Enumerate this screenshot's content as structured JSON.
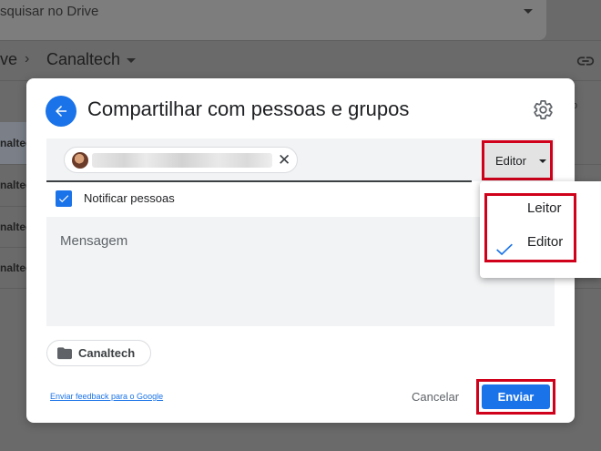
{
  "background": {
    "search_placeholder": "squisar no Drive",
    "breadcrumb_prev": "ve",
    "breadcrumb_current": "Canaltech",
    "file_rows": [
      "naltec",
      "naltec",
      "naltec",
      "naltec"
    ],
    "right_text": "o"
  },
  "dialog": {
    "title": "Compartilhar com pessoas e grupos",
    "role_button_label": "Editor",
    "notify_label": "Notificar pessoas",
    "notify_checked": true,
    "message_placeholder": "Mensagem",
    "folder_chip_label": "Canaltech",
    "feedback_link": "Enviar feedback para o Google",
    "cancel_label": "Cancelar",
    "send_label": "Enviar"
  },
  "role_menu": {
    "items": [
      {
        "label": "Leitor",
        "selected": false
      },
      {
        "label": "Editor",
        "selected": true
      }
    ]
  },
  "colors": {
    "accent": "#1a73e8",
    "highlight": "#d0021b"
  }
}
